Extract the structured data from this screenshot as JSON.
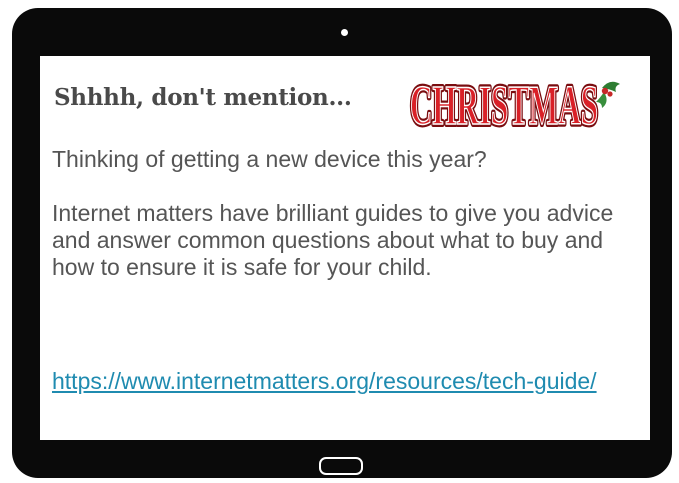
{
  "headline": "Shhhh, don't mention...",
  "logo": {
    "text": "CHRISTMAS",
    "colors": {
      "fill": "#d92027",
      "outline": "#7a0d10",
      "holly": "#2e7d32",
      "berry": "#c62828"
    }
  },
  "body": {
    "question": "Thinking of getting a new device this year?",
    "paragraph": "Internet matters have brilliant guides to give you advice and answer common questions about what to buy and how to ensure it is safe for your child."
  },
  "link": {
    "text": "https://www.internetmatters.org/resources/tech-guide/",
    "color": "#1f8bb0"
  },
  "colors": {
    "frame": "#0a0a0a",
    "screen": "#ffffff",
    "text": "#555555",
    "headline": "#4a4a4a"
  }
}
